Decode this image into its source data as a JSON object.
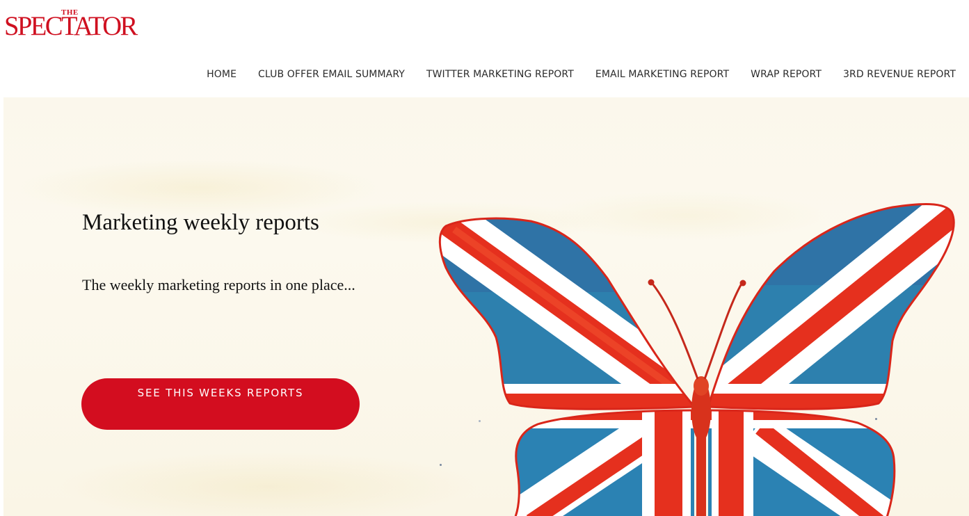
{
  "brand": {
    "logo_small": "THE",
    "logo_big": "SPECTATOR"
  },
  "nav": {
    "items": [
      {
        "label": "HOME"
      },
      {
        "label": "CLUB OFFER EMAIL SUMMARY"
      },
      {
        "label": "TWITTER MARKETING REPORT"
      },
      {
        "label": "EMAIL MARKETING REPORT"
      },
      {
        "label": "WRAP REPORT"
      },
      {
        "label": "3RD REVENUE REPORT"
      }
    ]
  },
  "hero": {
    "title": "Marketing weekly reports",
    "subtitle": "The weekly marketing reports in one place...",
    "cta_label": "SEE THIS WEEKS REPORTS",
    "illustration_icon": "union-jack-butterfly-icon"
  },
  "colors": {
    "brand_red": "#cf1020",
    "cta_red": "#d30d1f",
    "flag_blue": "#2a78a8",
    "flag_red": "#e5301e",
    "background": "#fbf7ec"
  }
}
